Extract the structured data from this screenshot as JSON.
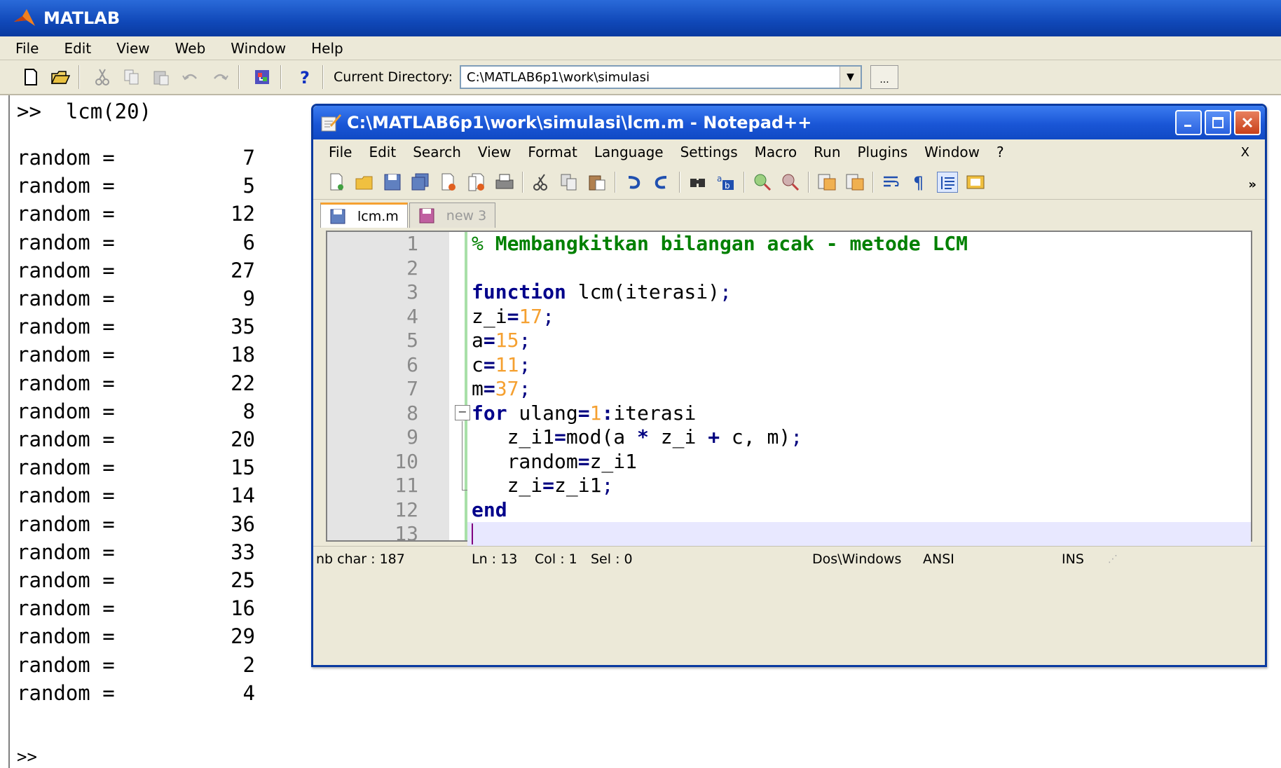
{
  "matlab": {
    "title": "MATLAB",
    "menu": [
      "File",
      "Edit",
      "View",
      "Web",
      "Window",
      "Help"
    ],
    "current_dir_label": "Current Directory:",
    "current_dir_value": "C:\\MATLAB6p1\\work\\simulasi",
    "browse_label": "...",
    "command": ">>  lcm(20)",
    "output_label": "random =",
    "output_values": [
      "7",
      "5",
      "12",
      "6",
      "27",
      "9",
      "35",
      "18",
      "22",
      "8",
      "20",
      "15",
      "14",
      "36",
      "33",
      "25",
      "16",
      "29",
      "2",
      "4"
    ],
    "final_prompt": ">>"
  },
  "notepad": {
    "title": "C:\\MATLAB6p1\\work\\simulasi\\lcm.m - Notepad++",
    "menu": [
      "File",
      "Edit",
      "Search",
      "View",
      "Format",
      "Language",
      "Settings",
      "Macro",
      "Run",
      "Plugins",
      "Window",
      "?"
    ],
    "close_x": "X",
    "tabs": [
      {
        "label": "lcm.m",
        "active": true
      },
      {
        "label": "new 3",
        "active": false
      }
    ],
    "line_numbers": [
      "1",
      "2",
      "3",
      "4",
      "5",
      "6",
      "7",
      "8",
      "9",
      "10",
      "11",
      "12",
      "13"
    ],
    "status": {
      "chars": "nb char : 187",
      "ln": "Ln : 13",
      "col": "Col : 1",
      "sel": "Sel : 0",
      "eol": "Dos\\Windows",
      "encoding": "ANSI",
      "mode": "INS"
    },
    "colors": {
      "keyword": "#00008b",
      "number": "#f5a030",
      "comment": "#008000",
      "caret_line": "#e8e8ff"
    }
  }
}
